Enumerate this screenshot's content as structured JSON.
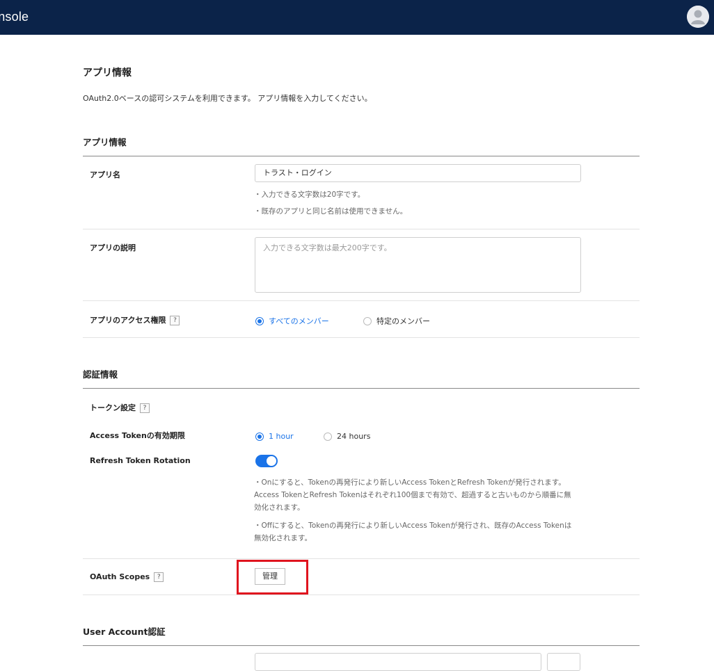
{
  "header": {
    "brand": "onsole",
    "avatar_icon": "user-avatar-icon"
  },
  "page": {
    "title": "アプリ情報",
    "description": "OAuth2.0ベースの認可システムを利用できます。 アプリ情報を入力してください。"
  },
  "app_info": {
    "section_title": "アプリ情報",
    "app_name": {
      "label": "アプリ名",
      "value": "トラスト・ログイン",
      "notes": [
        "入力できる文字数は20字です。",
        "既存のアプリと同じ名前は使用できません。"
      ]
    },
    "app_description": {
      "label": "アプリの説明",
      "placeholder": "入力できる文字数は最大200字です。"
    },
    "access": {
      "label": "アプリのアクセス権限",
      "help": "?",
      "options": [
        "すべてのメンバー",
        "特定のメンバー"
      ],
      "selected": "すべてのメンバー"
    }
  },
  "auth_info": {
    "section_title": "認証情報",
    "token_settings": {
      "label": "トークン設定",
      "help": "?"
    },
    "access_token_expiry": {
      "label": "Access Tokenの有効期限",
      "options": [
        "1 hour",
        "24 hours"
      ],
      "selected": "1 hour"
    },
    "refresh_rotation": {
      "label": "Refresh Token Rotation",
      "enabled": true,
      "notes": [
        "Onにすると、Tokenの再発行により新しいAccess TokenとRefresh Tokenが発行されます。Access TokenとRefresh Tokenはそれぞれ100個まで有効で、超過すると古いものから順番に無効化されます。",
        "Offにすると、Tokenの再発行により新しいAccess Tokenが発行され、既存のAccess Tokenは無効化されます。"
      ]
    },
    "oauth_scopes": {
      "label": "OAuth Scopes",
      "help": "?",
      "button": "管理"
    }
  },
  "user_account": {
    "section_title": "User Account認証"
  },
  "colors": {
    "topbar": "#0b2349",
    "accent": "#1a73e8",
    "highlight": "#e0141e"
  }
}
